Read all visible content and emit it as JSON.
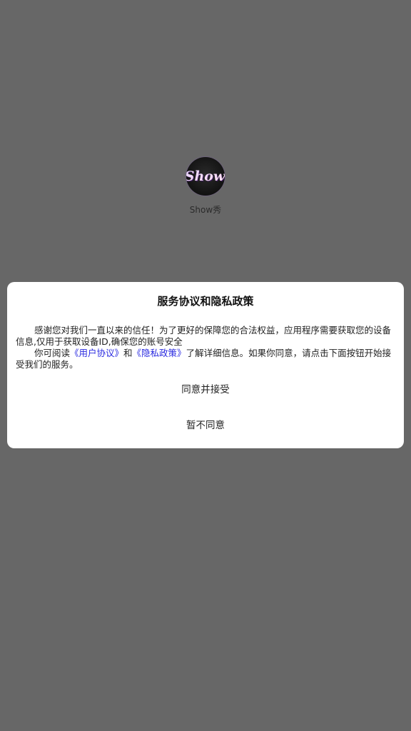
{
  "app": {
    "icon": "show-app-logo",
    "icon_text": "Show",
    "name": "Show秀"
  },
  "dialog": {
    "title": "服务协议和隐私政策",
    "paragraph1": "感谢您对我们一直以来的信任！为了更好的保障您的合法权益，应用程序需要获取您的设备信息,仅用于获取设备ID,确保您的账号安全",
    "paragraph2_prefix": "你可阅读",
    "user_agreement_link": "《用户协议》",
    "and_text": "和",
    "privacy_policy_link": "《隐私政策》",
    "paragraph2_suffix": "了解详细信息。如果你同意，请点击下面按钮开始接受我们的服务。",
    "accept_button": "同意并接受",
    "decline_button": "暂不同意"
  },
  "colors": {
    "overlay": "#676767",
    "dialog_bg": "#ffffff",
    "link": "#2a2ae0",
    "text": "#222222"
  }
}
